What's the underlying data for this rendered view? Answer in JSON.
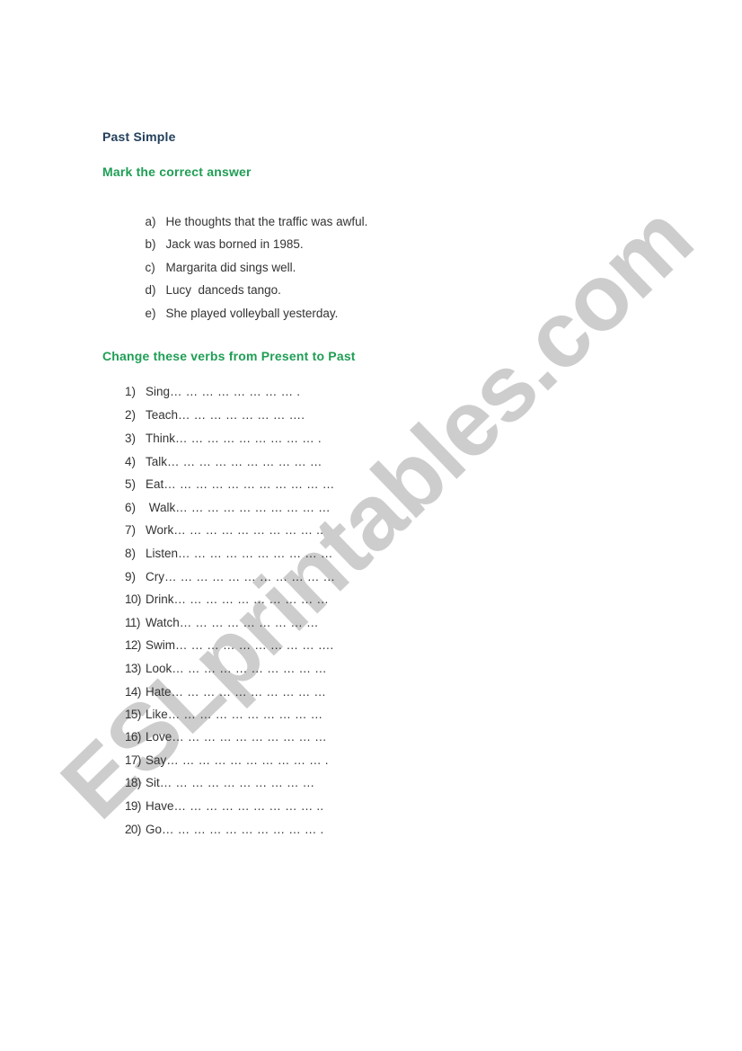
{
  "document": {
    "title": "Past Simple",
    "section1": {
      "heading": "Mark the correct answer",
      "items": [
        {
          "marker": "a)",
          "text": "He thoughts that the traffic was awful."
        },
        {
          "marker": "b)",
          "text": "Jack was borned in 1985."
        },
        {
          "marker": "c)",
          "text": "Margarita did sings well."
        },
        {
          "marker": "d)",
          "text": "Lucy  danceds tango."
        },
        {
          "marker": "e)",
          "text": "She played volleyball yesterday."
        }
      ]
    },
    "section2": {
      "heading": "Change these verbs from Present to Past",
      "items": [
        {
          "marker": "1)",
          "text": "Sing",
          "blank": "… … … … … … … … ."
        },
        {
          "marker": "2)",
          "text": "Teach",
          "blank": "… … … … … … … …."
        },
        {
          "marker": "3)",
          "text": "Think",
          "blank": "… … … … … … … … … ."
        },
        {
          "marker": "4)",
          "text": "Talk",
          "blank": "… … … … … … … … … …"
        },
        {
          "marker": "5)",
          "text": "Eat",
          "blank": "… … … … … … … … … … …"
        },
        {
          "marker": "6)",
          "text": " Walk",
          "blank": "… … … … … … … … … …"
        },
        {
          "marker": "7)",
          "text": "Work",
          "blank": "… … … … … … … … … .."
        },
        {
          "marker": "8)",
          "text": "Listen",
          "blank": "… … … … … … … … … …"
        },
        {
          "marker": "9)",
          "text": "Cry",
          "blank": "… … … … … … … … … … …"
        },
        {
          "marker": "10)",
          "text": "Drink",
          "blank": "… … … … … … … … … …"
        },
        {
          "marker": "11)",
          "text": "Watch",
          "blank": "… … … … … … … … …"
        },
        {
          "marker": "12)",
          "text": "Swim",
          "blank": "… … … … … … … … … …."
        },
        {
          "marker": "13)",
          "text": "Look",
          "blank": "… … … … … … … … … …"
        },
        {
          "marker": "14)",
          "text": "Hate",
          "blank": "… … … … … … … … … …"
        },
        {
          "marker": "15)",
          "text": "Like",
          "blank": "… … … … … … … … … …"
        },
        {
          "marker": "16)",
          "text": "Love",
          "blank": "… … … … … … … … … …"
        },
        {
          "marker": "17)",
          "text": "Say",
          "blank": "… … … … … … … … … … ."
        },
        {
          "marker": "18)",
          "text": "Sit",
          "blank": "… … … … … … … … … …"
        },
        {
          "marker": "19)",
          "text": "Have",
          "blank": "… … … … … … … … … .."
        },
        {
          "marker": "20)",
          "text": "Go",
          "blank": "… … … … … … … … … … ."
        }
      ]
    }
  },
  "watermark": {
    "text": "ESLprintables.com",
    "color": "#c9c9c9"
  },
  "colors": {
    "title": "#23405c",
    "heading": "#1f9e55",
    "body_text": "#333333"
  }
}
